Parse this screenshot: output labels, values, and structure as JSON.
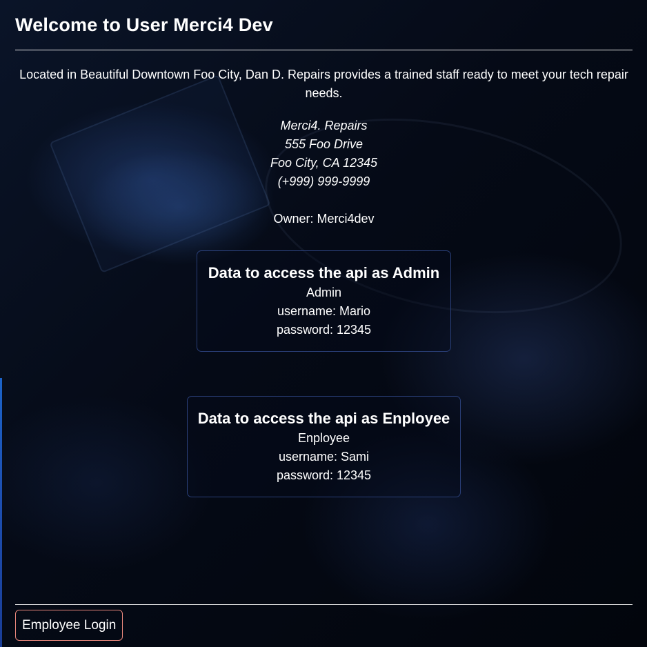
{
  "header": {
    "title": "Welcome to User Merci4 Dev"
  },
  "intro": {
    "text": "Located in Beautiful Downtown Foo City, Dan D. Repairs provides a trained staff ready to meet your tech repair needs."
  },
  "address": {
    "name": "Merci4. Repairs",
    "street": "555 Foo Drive",
    "city": "Foo City, CA 12345",
    "phone": "(+999) 999-9999"
  },
  "owner": {
    "text": "Owner: Merci4dev"
  },
  "cards": [
    {
      "title": "Data to access the api as Admin",
      "role": "Admin",
      "username": "username: Mario",
      "password": "password: 12345"
    },
    {
      "title": "Data to access the api as Enployee",
      "role": "Enployee",
      "username": "username: Sami",
      "password": "password: 12345"
    }
  ],
  "footer": {
    "login_label": "Employee Login"
  },
  "colors": {
    "accent_border": "#2a3f78",
    "login_border": "#e8877c",
    "side_accent": "#1c63c8"
  }
}
